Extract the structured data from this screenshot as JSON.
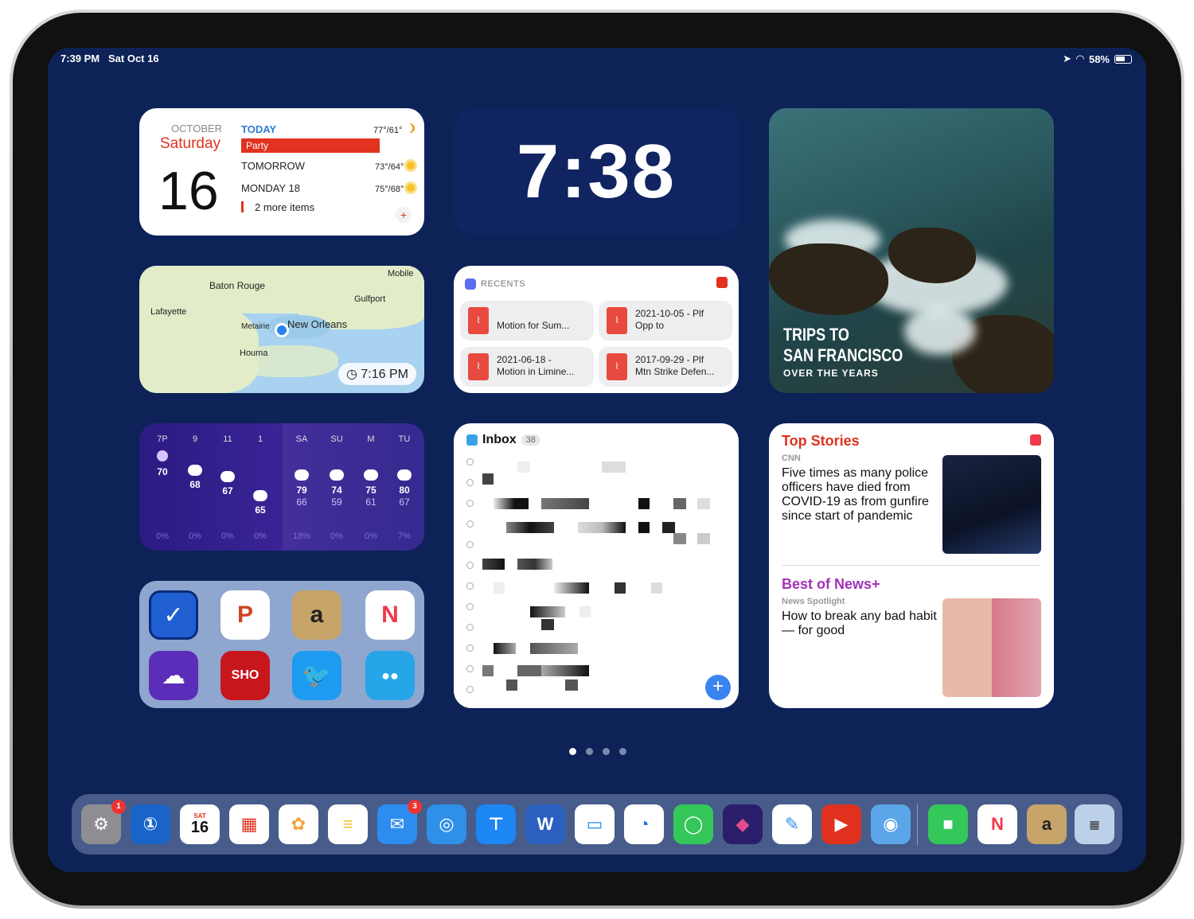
{
  "status": {
    "time": "7:39 PM",
    "date": "Sat Oct 16",
    "battery": "58%"
  },
  "calendar": {
    "month": "OCTOBER",
    "weekday": "Saturday",
    "day": "16",
    "today_label": "TODAY",
    "today_temp": "77°/61°",
    "event": "Party",
    "tomorrow_label": "TOMORROW",
    "tomorrow_temp": "73°/64°",
    "monday_label": "MONDAY 18",
    "monday_temp": "75°/68°",
    "more": "2 more items"
  },
  "clock": {
    "time": "7:38"
  },
  "photo": {
    "title_line1": "TRIPS TO",
    "title_line2": "SAN FRANCISCO",
    "subtitle": "OVER THE YEARS"
  },
  "map": {
    "cities": [
      "Baton Rouge",
      "Mobile",
      "Gulfport",
      "Lafayette",
      "Metairie",
      "New Orleans",
      "Houma"
    ],
    "time": "7:16 PM"
  },
  "recents": {
    "header": "RECENTS",
    "items": [
      {
        "line1": "",
        "line2": "Motion for Sum..."
      },
      {
        "line1": "2021-10-05 - Plf",
        "line2": "Opp to"
      },
      {
        "line1": "2021-06-18 -",
        "line2": "Motion in Limine..."
      },
      {
        "line1": "2017-09-29 - Plf",
        "line2": "Mtn Strike Defen..."
      }
    ]
  },
  "weather": {
    "hours": [
      {
        "label": "7P",
        "temp": "70",
        "low": "",
        "pct": "0%"
      },
      {
        "label": "9",
        "temp": "68",
        "low": "",
        "pct": "0%"
      },
      {
        "label": "11",
        "temp": "67",
        "low": "",
        "pct": "0%"
      },
      {
        "label": "1",
        "temp": "65",
        "low": "",
        "pct": "0%"
      },
      {
        "label": "SA",
        "temp": "79",
        "low": "66",
        "pct": "18%"
      },
      {
        "label": "SU",
        "temp": "74",
        "low": "59",
        "pct": "0%"
      },
      {
        "label": "M",
        "temp": "75",
        "low": "61",
        "pct": "0%"
      },
      {
        "label": "TU",
        "temp": "80",
        "low": "67",
        "pct": "7%"
      }
    ]
  },
  "inbox": {
    "title": "Inbox",
    "count": "38",
    "add": "+"
  },
  "news": {
    "section1": "Top Stories",
    "source1": "CNN",
    "headline1": "Five times as many police officers have died from COVID-19 as from gunfire since start of pandemic",
    "section2": "Best of News+",
    "source2": "News Spotlight",
    "headline2": "How to break any bad habit — for good"
  },
  "apps_widget": [
    {
      "name": "things",
      "glyph": "✓",
      "color": "#1f5fd1"
    },
    {
      "name": "powerpoint",
      "glyph": "P",
      "color": "#d04423"
    },
    {
      "name": "amazon",
      "glyph": "a",
      "color": "#c7a46a"
    },
    {
      "name": "news",
      "glyph": "N",
      "color": "#f03a4a"
    },
    {
      "name": "carrot-weather",
      "glyph": "☁",
      "color": "#6a33c9"
    },
    {
      "name": "showtime",
      "glyph": "SHO",
      "color": "#c8161d"
    },
    {
      "name": "twitter",
      "glyph": "🐦",
      "color": "#1d9bf0"
    },
    {
      "name": "tweetbot-like",
      "glyph": "●●",
      "color": "#26a6e8"
    }
  ],
  "dock": {
    "settings_badge": "1",
    "calendar_day": "SAT",
    "calendar_date": "16",
    "mail_badge": "3"
  }
}
